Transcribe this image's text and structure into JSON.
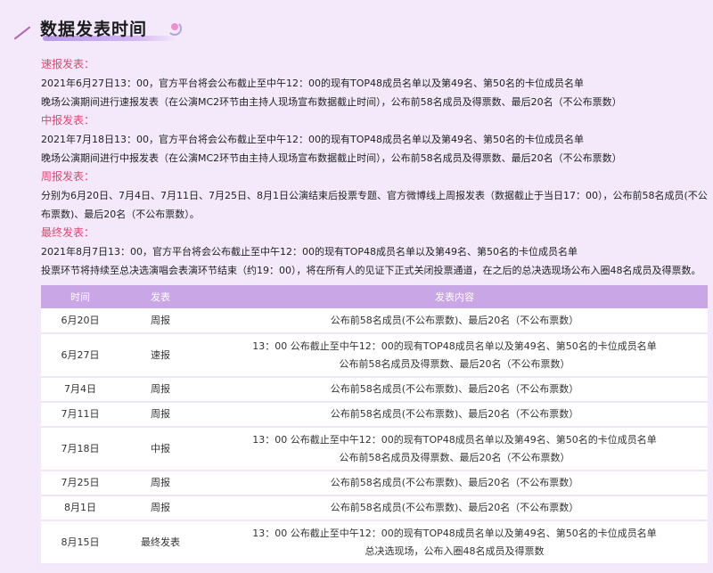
{
  "title": "数据发表时间",
  "sections": [
    {
      "label": "速报发表：",
      "lines": [
        "2021年6月27日13：00，官方平台将会公布截止至中午12：00的现有TOP48成员名单以及第49名、第50名的卡位成员名单",
        "晚场公演期间进行速报发表（在公演MC2环节由主持人现场宣布数据截止时间），公布前58名成员及得票数、最后20名（不公布票数）"
      ]
    },
    {
      "label": "中报发表：",
      "lines": [
        "2021年7月18日13：00，官方平台将会公布截止至中午12：00的现有TOP48成员名单以及第49名、第50名的卡位成员名单",
        "晚场公演期间进行中报发表（在公演MC2环节由主持人现场宣布数据截止时间），公布前58名成员及得票数、最后20名（不公布票数）"
      ]
    },
    {
      "label": "周报发表：",
      "lines": [
        "分别为6月20日、7月4日、7月11日、7月25日、8月1日公演结束后投票专题、官方微博线上周报发表（数据截止于当日17：00），公布前58名成员(不公布票数)、最后20名（不公布票数）。"
      ]
    },
    {
      "label": "最终发表：",
      "lines": [
        "2021年8月7日13：00，官方平台将会公布截止至中午12：00的现有TOP48成员名单以及第49名、第50名的卡位成员名单",
        "投票环节将持续至总决选演唱会表演环节结束（约19：00），将在所有人的见证下正式关闭投票通道，在之后的总决选现场公布入圈48名成员及得票数。"
      ]
    }
  ],
  "table": {
    "headers": [
      "时间",
      "发表",
      "发表内容"
    ],
    "rows": [
      {
        "date": "6月20日",
        "type": "周报",
        "content": [
          "公布前58名成员(不公布票数)、最后20名（不公布票数）"
        ]
      },
      {
        "date": "6月27日",
        "type": "速报",
        "content": [
          "13：00 公布截止至中午12：00的现有TOP48成员名单以及第49名、第50名的卡位成员名单",
          "公布前58名成员及得票数、最后20名（不公布票数）"
        ]
      },
      {
        "date": "7月4日",
        "type": "周报",
        "content": [
          "公布前58名成员(不公布票数)、最后20名（不公布票数）"
        ]
      },
      {
        "date": "7月11日",
        "type": "周报",
        "content": [
          "公布前58名成员(不公布票数)、最后20名（不公布票数）"
        ]
      },
      {
        "date": "7月18日",
        "type": "中报",
        "content": [
          "13：00 公布截止至中午12：00的现有TOP48成员名单以及第49名、第50名的卡位成员名单",
          "公布前58名成员及得票数、最后20名（不公布票数）"
        ]
      },
      {
        "date": "7月25日",
        "type": "周报",
        "content": [
          "公布前58名成员(不公布票数)、最后20名（不公布票数）"
        ]
      },
      {
        "date": "8月1日",
        "type": "周报",
        "content": [
          "公布前58名成员(不公布票数)、最后20名（不公布票数）"
        ]
      },
      {
        "date": "8月15日",
        "type": "最终发表",
        "content": [
          "13：00 公布截止至中午12：00的现有TOP48成员名单以及第49名、第50名的卡位成员名单",
          "总决选现场，公布入圈48名成员及得票数"
        ]
      }
    ]
  }
}
